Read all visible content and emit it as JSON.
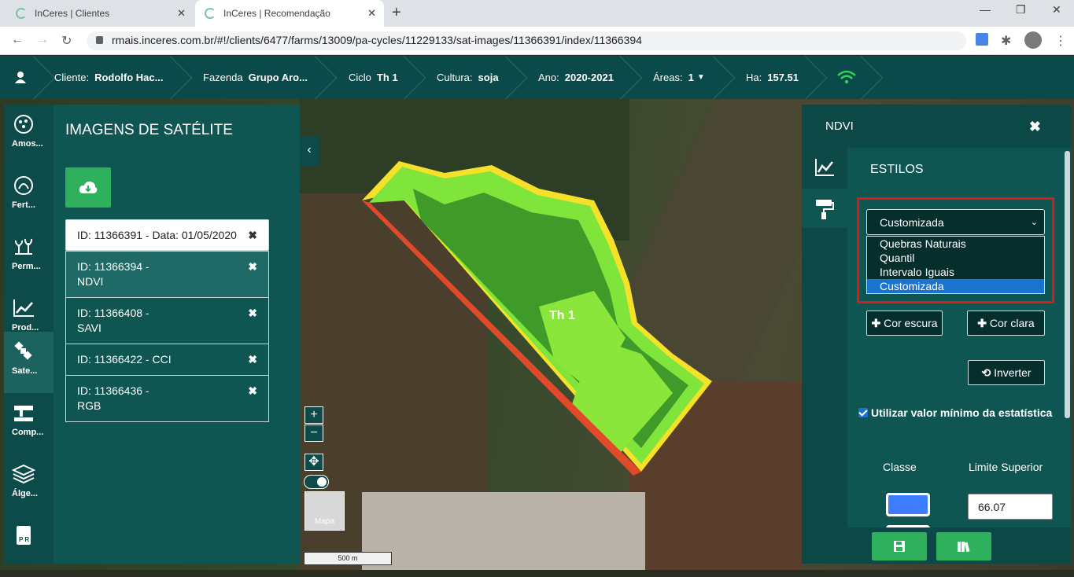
{
  "browser": {
    "tabs": [
      {
        "title": "InCeres | Clientes",
        "active": false
      },
      {
        "title": "InCeres | Recomendação",
        "active": true
      }
    ],
    "url": "rmais.inceres.com.br/#!/clients/6477/farms/13009/pa-cycles/11229133/sat-images/11366391/index/11366394"
  },
  "header": {
    "cliente_label": "Cliente:",
    "cliente_value": "Rodolfo Hac...",
    "fazenda_label": "Fazenda",
    "fazenda_value": "Grupo Aro...",
    "ciclo_label": "Ciclo",
    "ciclo_value": "Th 1",
    "cultura_label": "Cultura:",
    "cultura_value": "soja",
    "ano_label": "Ano:",
    "ano_value": "2020-2021",
    "areas_label": "Áreas:",
    "areas_value": "1",
    "ha_label": "Ha:",
    "ha_value": "157.51"
  },
  "rail": {
    "items": [
      {
        "label": "Amos...",
        "icon": "samples-icon",
        "active": false
      },
      {
        "label": "Fert...",
        "icon": "fertility-icon",
        "active": false
      },
      {
        "label": "Perm...",
        "icon": "plants-icon",
        "active": false
      },
      {
        "label": "Prod...",
        "icon": "productivity-chart-icon",
        "active": false
      },
      {
        "label": "Sate...",
        "icon": "satellite-icon",
        "active": true
      },
      {
        "label": "Comp...",
        "icon": "compaction-icon",
        "active": false
      },
      {
        "label": "Álge...",
        "icon": "layers-icon",
        "active": false
      },
      {
        "label": "",
        "icon": "pr-icon",
        "active": false
      }
    ]
  },
  "left_panel": {
    "title": "IMAGENS DE SATÉLITE",
    "rows": [
      {
        "line1": "ID: 11366391 - Data: 01/05/2020",
        "line2": ""
      },
      {
        "line1": "ID: 11366394 -",
        "line2": "NDVI"
      },
      {
        "line1": "ID: 11366408 -",
        "line2": "SAVI"
      },
      {
        "line1": "ID: 11366422 - CCI",
        "line2": ""
      },
      {
        "line1": "ID: 11366436 -",
        "line2": "RGB"
      }
    ],
    "remove_glyph": "✖"
  },
  "map": {
    "field_label": "Th 1",
    "basemap_label": "Mapa",
    "scale": "500 m",
    "zoom_in": "+",
    "zoom_out": "−"
  },
  "right_panel": {
    "title": "NDVI",
    "section": "ESTILOS",
    "select_value": "Customizada",
    "options": [
      "Quebras Naturais",
      "Quantil",
      "Intervalo Iguais",
      "Customizada"
    ],
    "selected_option": "Customizada",
    "btn_dark": "Cor escura",
    "btn_light": "Cor clara",
    "btn_invert": "Inverter",
    "checkbox_label": "Utilizar valor mínimo da estatística",
    "col_classe": "Classe",
    "col_limite": "Limite Superior",
    "row_value": "66.07",
    "swatch_color": "#3d7bff"
  }
}
